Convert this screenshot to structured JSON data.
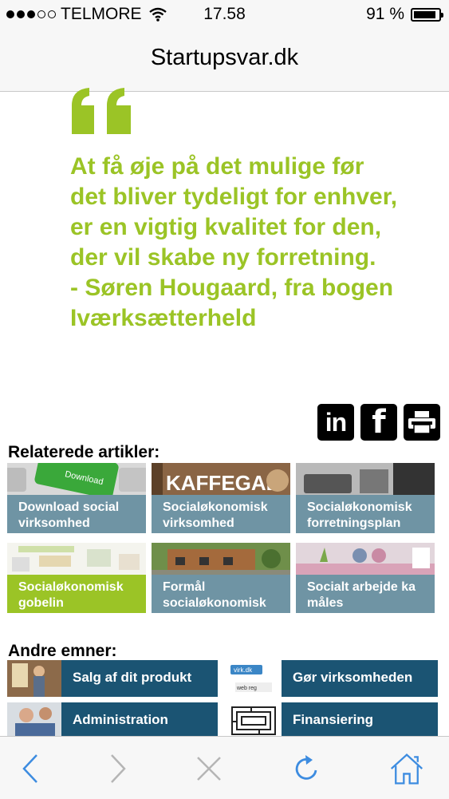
{
  "status": {
    "carrier": "TELMORE",
    "time": "17.58",
    "battery": "91 %",
    "battery_level": 0.91
  },
  "browser": {
    "title": "Startupsvar.dk"
  },
  "quote": {
    "lines": [
      "At få øje på det mulige før",
      "det bliver tydeligt for enhver,",
      "er en vigtig kvalitet for den,",
      "der vil skabe ny forretning.",
      "- Søren Hougaard, fra bogen",
      "Iværksætterheld"
    ],
    "color": "#9bc426"
  },
  "share": {
    "linkedin": "in",
    "facebook": "f"
  },
  "related": {
    "heading": "Relaterede artikler:",
    "items": [
      {
        "line1": "Download social",
        "line2": "virksomhed",
        "image_text": "Download"
      },
      {
        "line1": "Socialøkonomisk",
        "line2": "virksomhed",
        "image_text": "KAFFEGAL"
      },
      {
        "line1": "Socialøkonomisk",
        "line2": "forretningsplan"
      },
      {
        "line1": "Socialøkonomisk",
        "line2": "gobelin"
      },
      {
        "line1": "Formål",
        "line2": "socialøkonomisk"
      },
      {
        "line1": "Socialt arbejde ka",
        "line2": "måles"
      }
    ]
  },
  "topics": {
    "heading": "Andre emner:",
    "items": [
      {
        "label": "Salg af dit produkt"
      },
      {
        "label": "Gør virksomheden"
      },
      {
        "label": "Administration"
      },
      {
        "label": "Finansiering"
      }
    ]
  },
  "colors": {
    "teal": "#6f94a4",
    "lime": "#9bc426",
    "navy": "#1b5473",
    "ios_blue": "#3d8ce0"
  }
}
